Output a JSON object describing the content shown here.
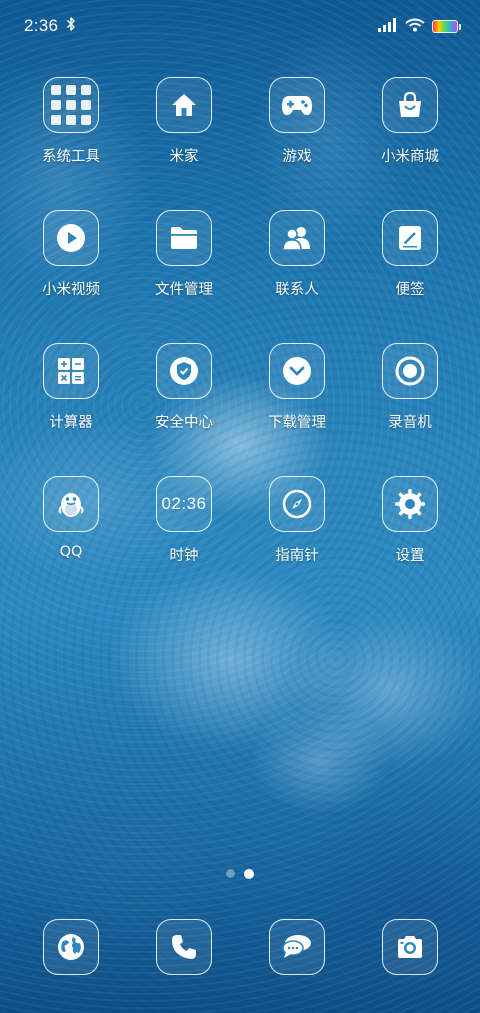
{
  "status_bar": {
    "time": "2:36",
    "bluetooth_icon": "bluetooth-icon",
    "signal_icon": "cellular-signal-icon",
    "wifi_icon": "wifi-icon",
    "battery_icon": "battery-icon"
  },
  "apps": [
    {
      "label": "系统工具",
      "icon": "folder-grid-icon"
    },
    {
      "label": "米家",
      "icon": "home-icon"
    },
    {
      "label": "游戏",
      "icon": "gamepad-icon"
    },
    {
      "label": "小米商城",
      "icon": "shopping-bag-icon"
    },
    {
      "label": "小米视频",
      "icon": "play-icon"
    },
    {
      "label": "文件管理",
      "icon": "folder-icon"
    },
    {
      "label": "联系人",
      "icon": "contacts-icon"
    },
    {
      "label": "便签",
      "icon": "notes-icon"
    },
    {
      "label": "计算器",
      "icon": "calculator-icon"
    },
    {
      "label": "安全中心",
      "icon": "shield-icon"
    },
    {
      "label": "下载管理",
      "icon": "download-icon"
    },
    {
      "label": "录音机",
      "icon": "record-icon"
    },
    {
      "label": "QQ",
      "icon": "penguin-icon"
    },
    {
      "label": "时钟",
      "icon": "clock-icon",
      "display": "02:36"
    },
    {
      "label": "指南针",
      "icon": "compass-icon"
    },
    {
      "label": "设置",
      "icon": "gear-icon"
    }
  ],
  "page_indicator": {
    "pages": 2,
    "active": 2
  },
  "dock": [
    {
      "icon": "browser-globe-icon"
    },
    {
      "icon": "phone-icon"
    },
    {
      "icon": "messages-icon"
    },
    {
      "icon": "camera-icon"
    }
  ],
  "colors": {
    "wallpaper_dark": "#0f5a95",
    "wallpaper_mid": "#2a86bd",
    "icon_outline": "#ffffff"
  }
}
